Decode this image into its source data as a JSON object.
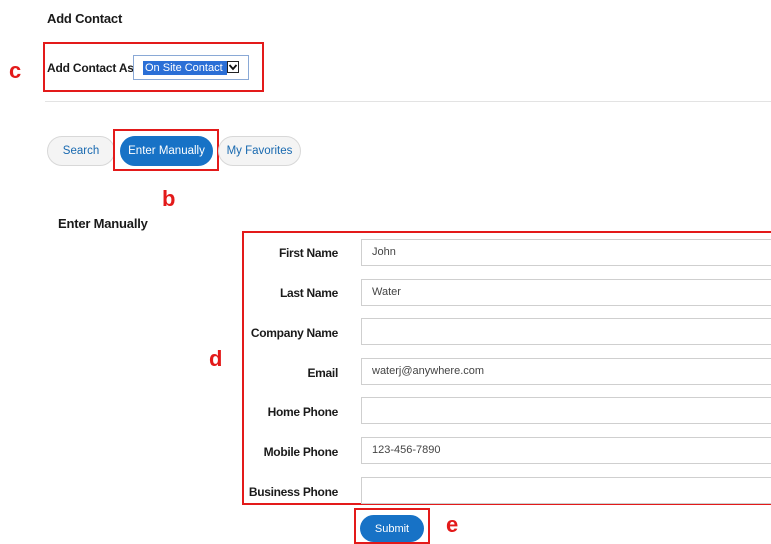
{
  "page": {
    "title": "Add Contact"
  },
  "add_contact_as": {
    "label": "Add Contact As",
    "selected": "On Site Contact"
  },
  "tabs": [
    {
      "label": "Search",
      "active": false
    },
    {
      "label": "Enter Manually",
      "active": true
    },
    {
      "label": "My Favorites",
      "active": false
    }
  ],
  "section": {
    "title": "Enter Manually"
  },
  "fields": [
    {
      "label": "First Name",
      "value": "John"
    },
    {
      "label": "Last Name",
      "value": "Water"
    },
    {
      "label": "Company Name",
      "value": ""
    },
    {
      "label": "Email",
      "value": "waterj@anywhere.com"
    },
    {
      "label": "Home Phone",
      "value": ""
    },
    {
      "label": "Mobile Phone",
      "value": "123-456-7890"
    },
    {
      "label": "Business Phone",
      "value": ""
    }
  ],
  "submit_label": "Submit",
  "callouts": {
    "c": "c",
    "b": "b",
    "d": "d",
    "e": "e"
  },
  "colors": {
    "accent": "#1772c6",
    "callout": "#e31a1a"
  }
}
